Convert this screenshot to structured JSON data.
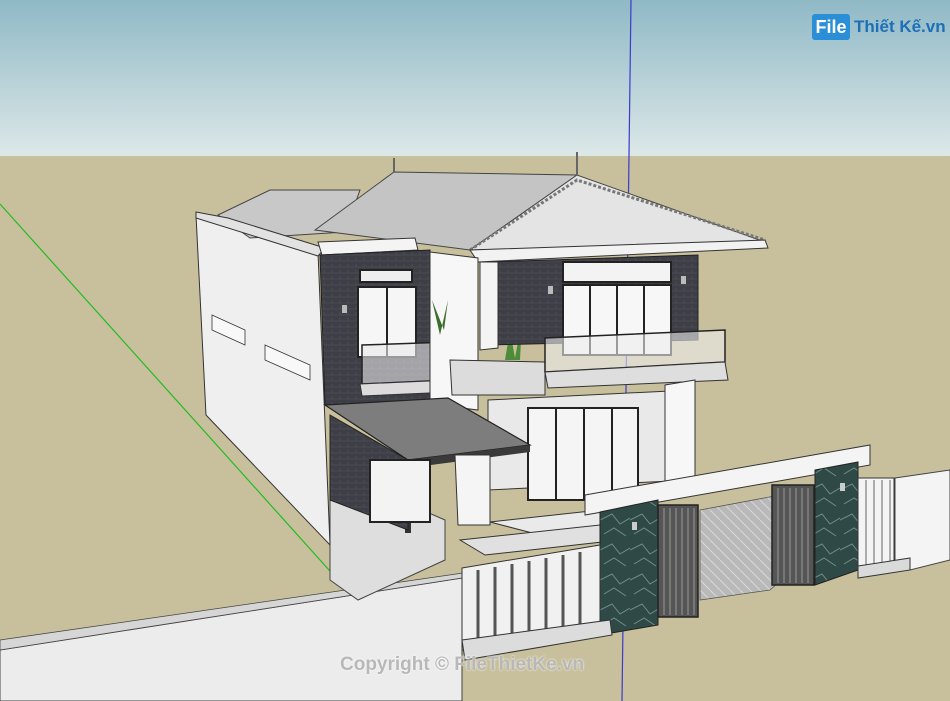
{
  "logo": {
    "box": "File",
    "text": "Thiết Kế.vn"
  },
  "watermark": "Copyright © FileThietKe.vn",
  "colors": {
    "sky_top": "#8fb9c6",
    "sky_bottom": "#d9e6e6",
    "ground": "#c8c09c",
    "green_axis": "#22bb22",
    "blue_axis": "#3a3acc",
    "dark_tile": "#3c3c44",
    "stone": "#2f4a48",
    "roof": "#c9c9c9",
    "wall": "#f2f2f2"
  }
}
